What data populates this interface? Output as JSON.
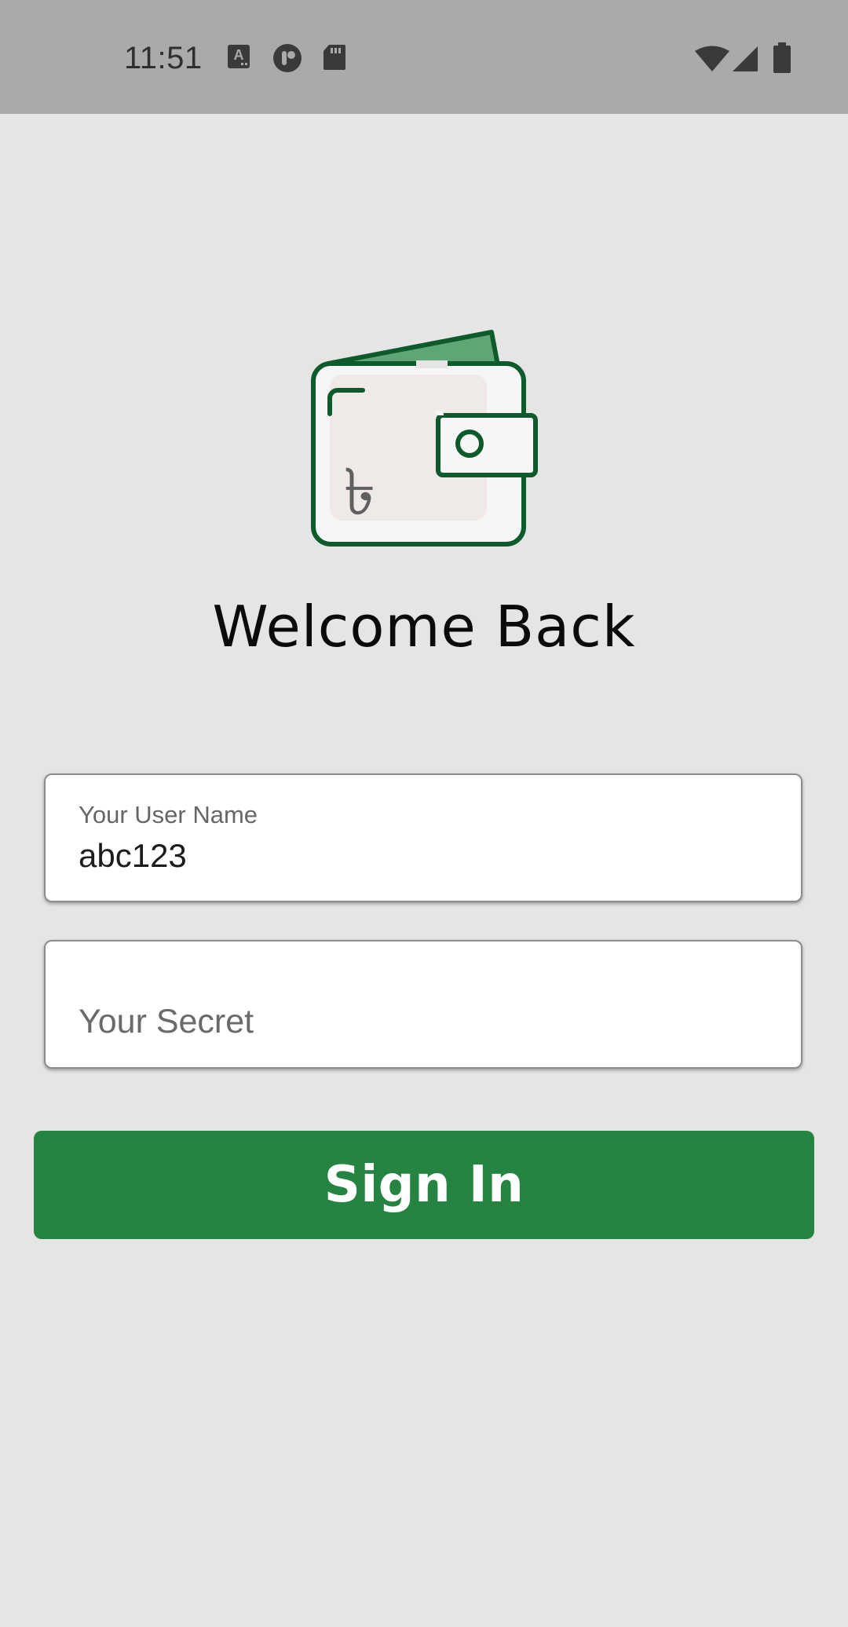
{
  "status_bar": {
    "time": "11:51",
    "notification_icons": [
      "keyboard-a-icon",
      "app-circle-icon",
      "sd-card-icon"
    ],
    "system_icons": [
      "wifi-icon",
      "cellular-signal-icon",
      "battery-icon"
    ]
  },
  "logo": {
    "icon": "wallet-icon",
    "currency_glyph": "৳"
  },
  "title": "Welcome Back",
  "form": {
    "username": {
      "label": "Your User Name",
      "value": "abc123"
    },
    "secret": {
      "placeholder": "Your Secret",
      "value": ""
    },
    "submit_label": "Sign In"
  },
  "colors": {
    "accent": "#268443",
    "wallet_outline": "#0e5a2c",
    "background": "#e5e5e5",
    "status_bar": "#aaaaaa"
  }
}
